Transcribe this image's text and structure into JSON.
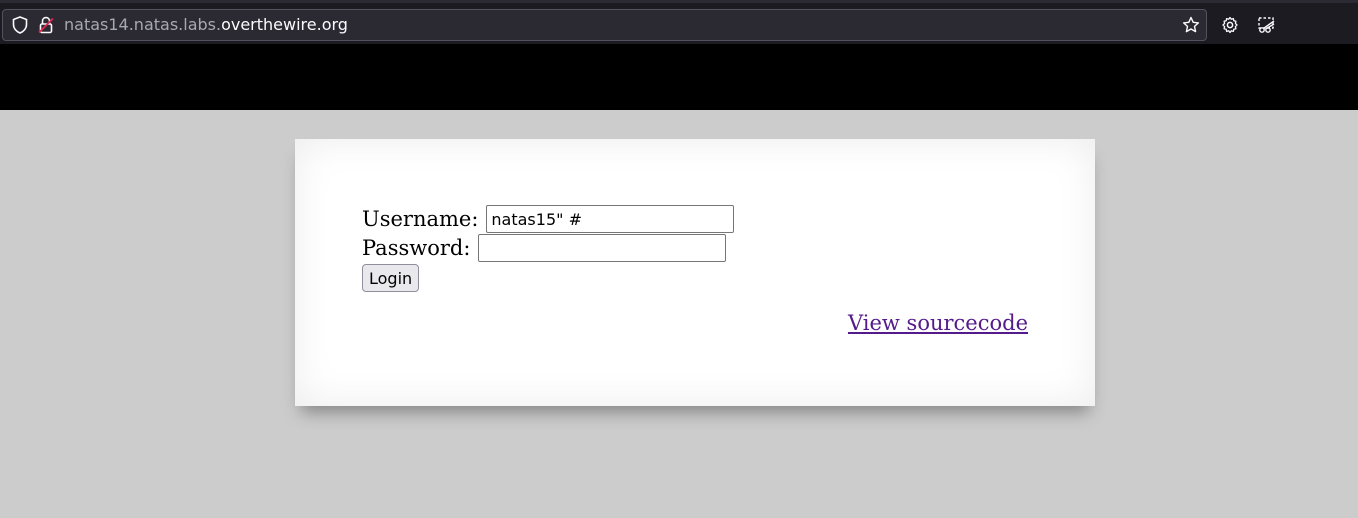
{
  "browser": {
    "url_subdomain": "natas14.natas.labs.",
    "url_domain": "overthewire.org",
    "icons": [
      "shield-icon",
      "lock-insecure-icon",
      "bookmark-star-icon",
      "settings-gear-icon",
      "screenshot-scissors-icon"
    ]
  },
  "form": {
    "username_label": "Username:",
    "username_value": "natas15\" #",
    "password_label": "Password:",
    "password_value": "",
    "login_label": "Login"
  },
  "links": {
    "view_source": "View sourcecode"
  },
  "colors": {
    "page_bg": "#cccccc",
    "band": "#000000",
    "link_visited": "#551a8b"
  }
}
